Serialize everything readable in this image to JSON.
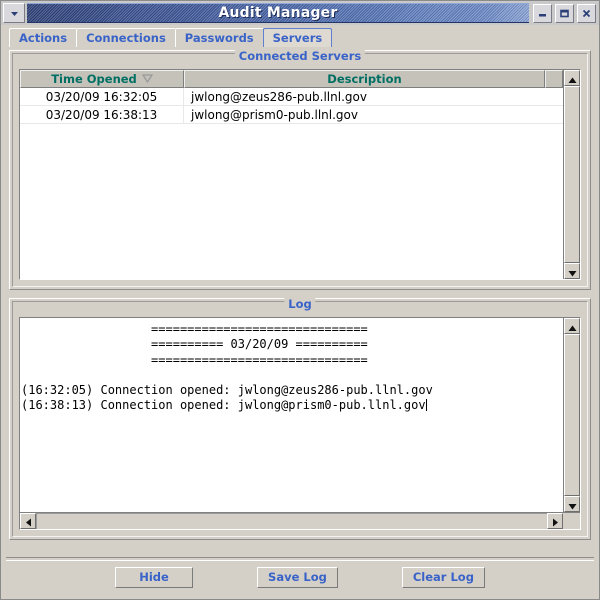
{
  "window": {
    "title": "Audit Manager",
    "menu_icon": "chevron-down-icon",
    "minimize_label": "−",
    "maximize_label": "□",
    "close_label": "✕",
    "accent_blue": "#3a63c8",
    "titlebar_blue": "#4a63a8",
    "header_teal": "#006f63",
    "face_gray": "#d4d0c8"
  },
  "tabs": [
    {
      "label": "Actions",
      "selected": false
    },
    {
      "label": "Connections",
      "selected": false
    },
    {
      "label": "Passwords",
      "selected": false
    },
    {
      "label": "Servers",
      "selected": true
    }
  ],
  "connected_servers": {
    "panel_title": "Connected Servers",
    "columns": [
      {
        "label": "Time Opened",
        "sort": "descending",
        "sort_icon": "triangle-down-icon"
      },
      {
        "label": "Description",
        "sort": "none"
      }
    ],
    "rows": [
      {
        "time_opened": "03/20/09 16:32:05",
        "description": "jwlong@zeus286-pub.llnl.gov"
      },
      {
        "time_opened": "03/20/09 16:38:13",
        "description": "jwlong@prism0-pub.llnl.gov"
      }
    ],
    "scrollbar": {
      "up_icon": "triangle-up-icon",
      "down_icon": "triangle-down-icon"
    }
  },
  "log": {
    "panel_title": "Log",
    "content": "                  ==============================\n                  ========== 03/20/09 ==========\n                  ==============================\n\n(16:32:05) Connection opened: jwlong@zeus286-pub.llnl.gov\n(16:38:13) Connection opened: jwlong@prism0-pub.llnl.gov",
    "vscrollbar": {
      "up_icon": "triangle-up-icon",
      "down_icon": "triangle-down-icon"
    },
    "hscrollbar": {
      "left_icon": "triangle-left-icon",
      "right_icon": "triangle-right-icon"
    }
  },
  "buttons": [
    {
      "label": "Hide",
      "name": "hide-button"
    },
    {
      "label": "Save Log",
      "name": "save-log-button"
    },
    {
      "label": "Clear Log",
      "name": "clear-log-button"
    }
  ]
}
